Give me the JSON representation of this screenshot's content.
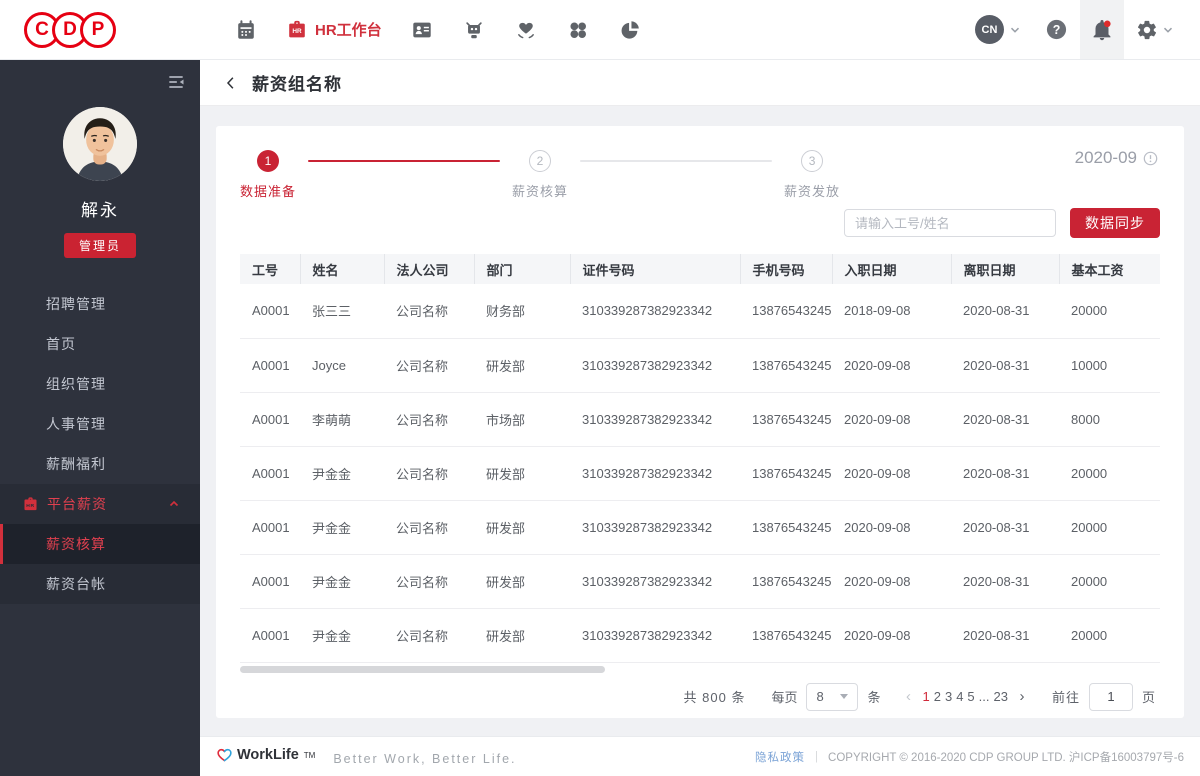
{
  "brand": {
    "letters": [
      "C",
      "D",
      "P"
    ],
    "accent": "#c92334",
    "logo_red": "#e60012"
  },
  "topnav": {
    "hr_badge": "HR",
    "workbench_label": "HR工作台",
    "locale": "CN",
    "help_glyph": "?"
  },
  "sidebar": {
    "user": {
      "name": "解永",
      "role_badge": "管理员"
    },
    "menu": [
      {
        "label": "招聘管理"
      },
      {
        "label": "首页"
      },
      {
        "label": "组织管理"
      },
      {
        "label": "人事管理"
      },
      {
        "label": "薪酬福利"
      }
    ],
    "group": {
      "label": "平台薪资",
      "children": [
        {
          "label": "薪资核算",
          "active": true
        },
        {
          "label": "薪资台帐",
          "active": false
        }
      ]
    }
  },
  "page": {
    "title": "薪资组名称",
    "period": "2020-09",
    "steps": [
      {
        "num": "1",
        "label": "数据准备",
        "state": "active"
      },
      {
        "num": "2",
        "label": "薪资核算",
        "state": "pending"
      },
      {
        "num": "3",
        "label": "薪资发放",
        "state": "pending"
      }
    ],
    "search_placeholder": "请输入工号/姓名",
    "sync_button": "数据同步"
  },
  "table": {
    "columns": [
      "工号",
      "姓名",
      "法人公司",
      "部门",
      "证件号码",
      "手机号码",
      "入职日期",
      "离职日期",
      "基本工资"
    ],
    "rows": [
      [
        "A0001",
        "张三三",
        "公司名称",
        "财务部",
        "310339287382923342",
        "13876543245",
        "2018-09-08",
        "2020-08-31",
        "20000"
      ],
      [
        "A0001",
        "Joyce",
        "公司名称",
        "研发部",
        "310339287382923342",
        "13876543245",
        "2020-09-08",
        "2020-08-31",
        "10000"
      ],
      [
        "A0001",
        "李萌萌",
        "公司名称",
        "市场部",
        "310339287382923342",
        "13876543245",
        "2020-09-08",
        "2020-08-31",
        "8000"
      ],
      [
        "A0001",
        "尹金金",
        "公司名称",
        "研发部",
        "310339287382923342",
        "13876543245",
        "2020-09-08",
        "2020-08-31",
        "20000"
      ],
      [
        "A0001",
        "尹金金",
        "公司名称",
        "研发部",
        "310339287382923342",
        "13876543245",
        "2020-09-08",
        "2020-08-31",
        "20000"
      ],
      [
        "A0001",
        "尹金金",
        "公司名称",
        "研发部",
        "310339287382923342",
        "13876543245",
        "2020-09-08",
        "2020-08-31",
        "20000"
      ],
      [
        "A0001",
        "尹金金",
        "公司名称",
        "研发部",
        "310339287382923342",
        "13876543245",
        "2020-09-08",
        "2020-08-31",
        "20000"
      ]
    ]
  },
  "pagination": {
    "total_text": "共 800 条",
    "per_page_label": "每页",
    "per_page_value": "8",
    "unit_label": "条",
    "prev_glyph": "‹",
    "next_glyph": "›",
    "pages": [
      "1",
      "2",
      "3",
      "4",
      "5",
      "...",
      "23"
    ],
    "current": "1",
    "goto_label": "前往",
    "goto_value": "1",
    "goto_unit": "页"
  },
  "footer": {
    "brand": "WorkLife",
    "tm": "TM",
    "slogan": "Better Work, Better Life.",
    "privacy_link": "隐私政策",
    "separator": "|",
    "copyright": "COPYRIGHT © 2016-2020 CDP GROUP LTD. 沪ICP备16003797号-6"
  }
}
